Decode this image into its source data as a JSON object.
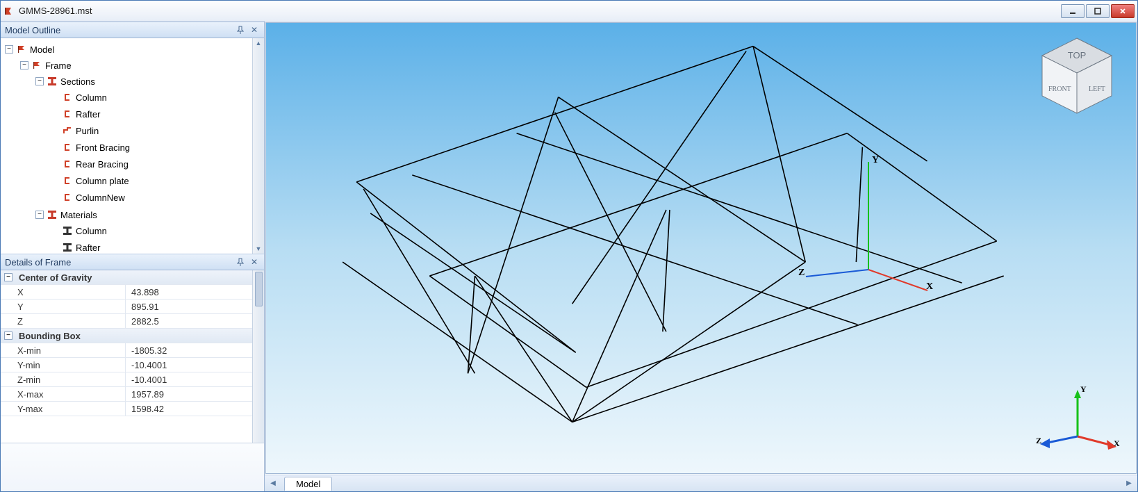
{
  "window": {
    "title": "GMMS-28961.mst"
  },
  "outline": {
    "panel_title": "Model Outline",
    "root": "Model",
    "frame": "Frame",
    "sections_label": "Sections",
    "sections": [
      "Column",
      "Rafter",
      "Purlin",
      "Front Bracing",
      "Rear Bracing",
      "Column plate",
      "ColumnNew"
    ],
    "materials_label": "Materials",
    "materials": [
      "Column",
      "Rafter"
    ]
  },
  "details": {
    "panel_title": "Details of Frame",
    "groups": [
      {
        "name": "Center of Gravity",
        "rows": [
          {
            "k": "X",
            "v": "43.898"
          },
          {
            "k": "Y",
            "v": "895.91"
          },
          {
            "k": "Z",
            "v": "2882.5"
          }
        ]
      },
      {
        "name": "Bounding Box",
        "rows": [
          {
            "k": "X-min",
            "v": "-1805.32"
          },
          {
            "k": "Y-min",
            "v": "-10.4001"
          },
          {
            "k": "Z-min",
            "v": "-10.4001"
          },
          {
            "k": "X-max",
            "v": "1957.89"
          },
          {
            "k": "Y-max",
            "v": "1598.42"
          }
        ]
      }
    ]
  },
  "viewport": {
    "tab": "Model",
    "viewcube": {
      "top": "TOP",
      "front": "FRONT",
      "left": "LEFT"
    },
    "axes": {
      "x": "X",
      "y": "Y",
      "z": "Z"
    }
  }
}
